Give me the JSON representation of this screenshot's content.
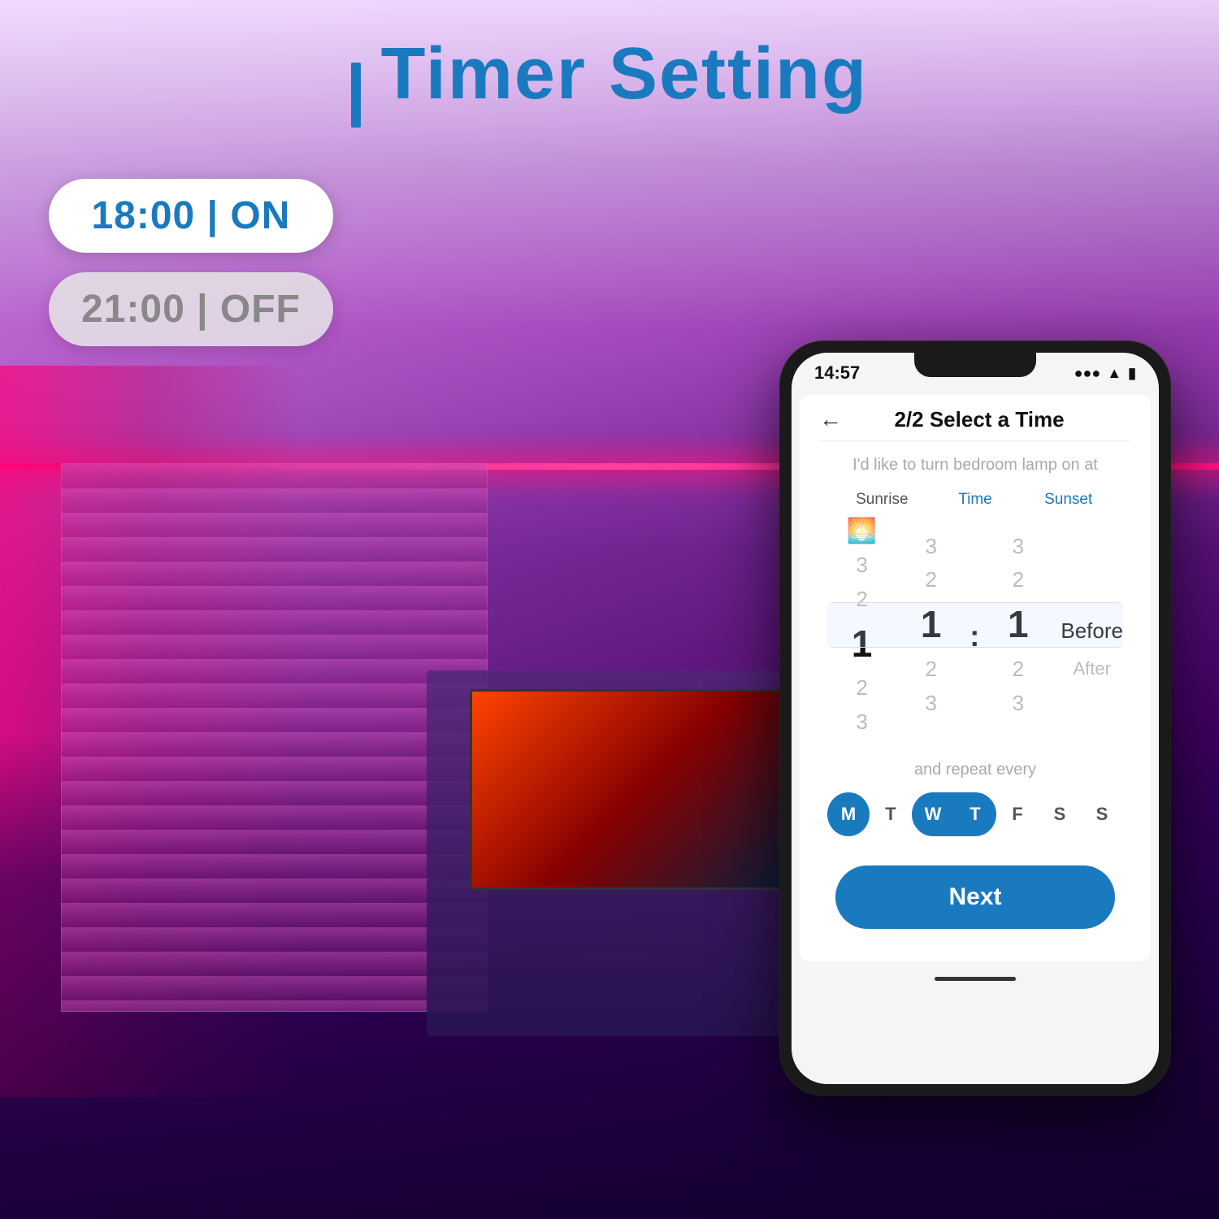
{
  "page": {
    "title": "Timer Setting",
    "title_bar": "|"
  },
  "timers": [
    {
      "time": "18:00",
      "state": "ON",
      "type": "on"
    },
    {
      "time": "21:00",
      "state": "OFF",
      "type": "off"
    }
  ],
  "phone": {
    "status_bar": {
      "time": "14:57",
      "signal": "●●●",
      "wifi": "wifi",
      "battery": "battery"
    },
    "app": {
      "back_label": "←",
      "step": "2/2",
      "screen_title": "Select a Time",
      "subtitle": "I'd like to turn bedroom lamp on at",
      "time_columns": {
        "label_left": "Sunrise",
        "label_middle": "Time",
        "label_right": "Sunset",
        "left_nums": [
          "3",
          "2",
          "1",
          "2",
          "3"
        ],
        "middle_nums_h": [
          "3",
          "2",
          "1",
          "2",
          "3"
        ],
        "middle_nums_m": [
          "3",
          "2",
          "1",
          "2",
          "3"
        ],
        "before_label": "Before",
        "after_label": "After"
      },
      "repeat_label": "and repeat every",
      "days": [
        {
          "label": "M",
          "state": "active"
        },
        {
          "label": "T",
          "state": "inactive"
        },
        {
          "label": "W",
          "state": "range-start"
        },
        {
          "label": "T",
          "state": "range-end"
        },
        {
          "label": "F",
          "state": "inactive"
        },
        {
          "label": "S",
          "state": "inactive"
        },
        {
          "label": "S",
          "state": "inactive"
        }
      ],
      "next_button": "Next"
    }
  }
}
